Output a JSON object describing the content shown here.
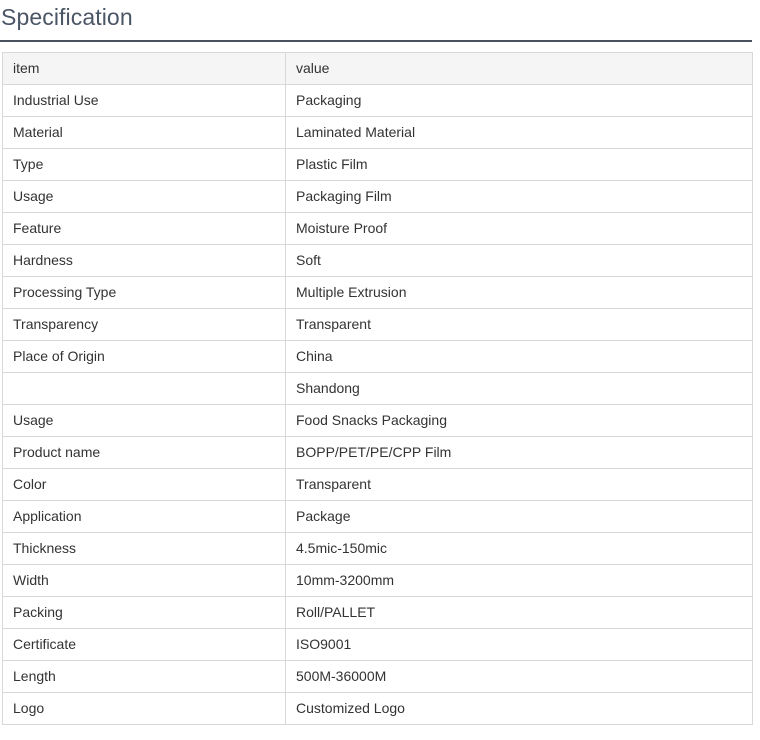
{
  "section": {
    "title": "Specification"
  },
  "table": {
    "header": {
      "item": "item",
      "value": "value"
    },
    "rows": [
      {
        "item": "Industrial Use",
        "value": "Packaging"
      },
      {
        "item": "Material",
        "value": "Laminated Material"
      },
      {
        "item": "Type",
        "value": "Plastic Film"
      },
      {
        "item": "Usage",
        "value": "Packaging Film"
      },
      {
        "item": "Feature",
        "value": "Moisture Proof"
      },
      {
        "item": "Hardness",
        "value": "Soft"
      },
      {
        "item": "Processing Type",
        "value": "Multiple Extrusion"
      },
      {
        "item": "Transparency",
        "value": "Transparent"
      },
      {
        "item": "Place of Origin",
        "value": "China"
      },
      {
        "item": "",
        "value": "Shandong"
      },
      {
        "item": "Usage",
        "value": "Food Snacks Packaging"
      },
      {
        "item": "Product name",
        "value": "BOPP/PET/PE/CPP Film"
      },
      {
        "item": "Color",
        "value": "Transparent"
      },
      {
        "item": "Application",
        "value": "Package"
      },
      {
        "item": "Thickness",
        "value": "4.5mic-150mic"
      },
      {
        "item": "Width",
        "value": "10mm-3200mm"
      },
      {
        "item": "Packing",
        "value": "Roll/PALLET"
      },
      {
        "item": "Certificate",
        "value": "ISO9001"
      },
      {
        "item": "Length",
        "value": "500M-36000M"
      },
      {
        "item": "Logo",
        "value": "Customized Logo"
      }
    ]
  }
}
